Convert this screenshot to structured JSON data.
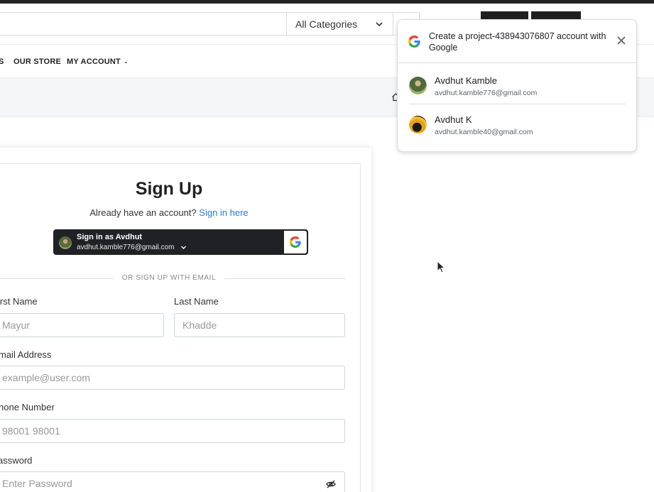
{
  "header": {
    "category_select": "All Categories"
  },
  "nav": {
    "items": [
      {
        "label": "S"
      },
      {
        "label": "OUR STORE"
      },
      {
        "label": "MY ACCOUNT"
      }
    ]
  },
  "signup": {
    "title": "Sign Up",
    "already_text": "Already have an account?",
    "signin_link": "Sign in here",
    "google_button": {
      "name": "Sign in as Avdhut",
      "email": "avdhut.kamble776@gmail.com"
    },
    "divider": "OR SIGN UP WITH EMAIL",
    "fields": {
      "first_name": {
        "label": "irst Name",
        "placeholder": "Mayur"
      },
      "last_name": {
        "label": "Last Name",
        "placeholder": "Khadde"
      },
      "email": {
        "label": "mail Address",
        "placeholder": "example@user.com"
      },
      "phone": {
        "label": "hone Number",
        "placeholder": "98001 98001"
      },
      "password": {
        "label": "assword",
        "placeholder": "Enter Password"
      }
    }
  },
  "google_popup": {
    "title": "Create a project-438943076807 account with Google",
    "accounts": [
      {
        "name": "Avdhut Kamble",
        "email": "avdhut.kamble776@gmail.com"
      },
      {
        "name": "Avdhut K",
        "email": "avdhut.kamble40@gmail.com"
      }
    ]
  },
  "colors": {
    "link": "#2a7ae2",
    "google_button_bg": "#202124",
    "topbar": "#222222"
  },
  "icons": [
    "chevron-down-icon",
    "home-icon",
    "google-logo-icon",
    "close-icon",
    "eye-off-icon",
    "mouse-cursor-icon"
  ]
}
